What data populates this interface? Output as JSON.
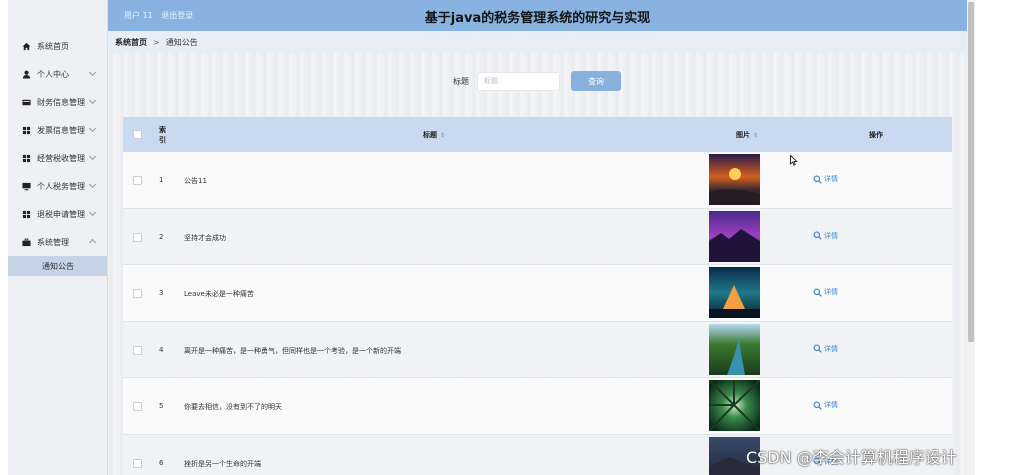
{
  "header": {
    "user_label": "用户 11",
    "logout_label": "退出登录",
    "title": "基于java的税务管理系统的研究与实现"
  },
  "sidebar": {
    "items": [
      {
        "label": "系统首页",
        "icon": "home-icon"
      },
      {
        "label": "个人中心",
        "icon": "user-icon"
      },
      {
        "label": "财务信息管理",
        "icon": "card-icon"
      },
      {
        "label": "发票信息管理",
        "icon": "grid-icon"
      },
      {
        "label": "经营税收管理",
        "icon": "grid-icon"
      },
      {
        "label": "个人税务管理",
        "icon": "monitor-icon"
      },
      {
        "label": "退税申请管理",
        "icon": "grid-icon"
      },
      {
        "label": "系统管理",
        "icon": "briefcase-icon"
      }
    ],
    "subitem": "通知公告"
  },
  "breadcrumb": {
    "home": "系统首页",
    "separator": ">",
    "current": "通知公告"
  },
  "search": {
    "label": "标题",
    "placeholder": "标题",
    "button": "查询"
  },
  "table": {
    "headers": {
      "index": "索引",
      "title": "标题",
      "image": "图片",
      "action": "操作"
    },
    "rows": [
      {
        "index": "1",
        "title": "公告11",
        "action": "详情"
      },
      {
        "index": "2",
        "title": "坚持才会成功",
        "action": "详情"
      },
      {
        "index": "3",
        "title": "Leave未必是一种痛苦",
        "action": "详情"
      },
      {
        "index": "4",
        "title": "离开是一种痛苦，是一种勇气，但同样也是一个考验，是一个新的开端",
        "action": "详情"
      },
      {
        "index": "5",
        "title": "你要去相信，没有到不了的明天",
        "action": "详情"
      },
      {
        "index": "6",
        "title": "挫折是另一个生命的开端",
        "action": "详情"
      }
    ]
  },
  "watermark": "CSDN @李会计算机程序设计",
  "colors": {
    "header": "#88b2e0",
    "accent": "#3e86d9",
    "table_head": "#c9daf0",
    "submenu": "#c5d3e6"
  }
}
